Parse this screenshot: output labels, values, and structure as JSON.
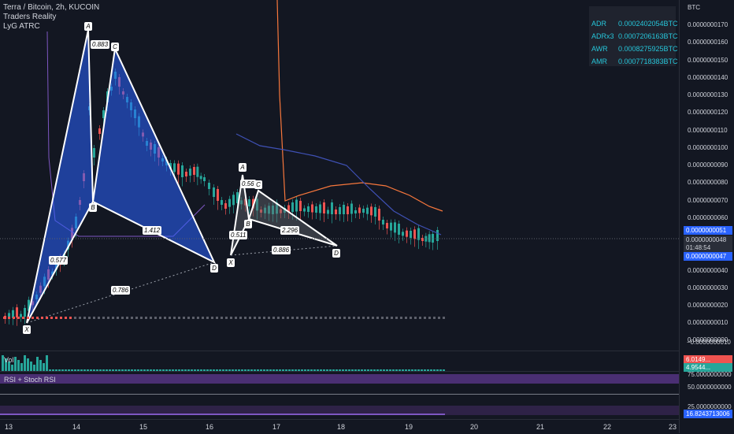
{
  "legend": {
    "title": "Terra / Bitcoin, 2h, KUCOIN",
    "indicator_1": "Traders Reality",
    "indicator_2": "LyG ATRC"
  },
  "stats": [
    {
      "key": "ADR",
      "value": "0.0002402054BTC"
    },
    {
      "key": "ADRx3",
      "value": "0.0007206163BTC"
    },
    {
      "key": "AWR",
      "value": "0.0008275925BTC"
    },
    {
      "key": "AMR",
      "value": "0.0007718383BTC"
    }
  ],
  "price_axis": {
    "unit": "BTC",
    "ticks": [
      "0.0000000170",
      "0.0000000160",
      "0.0000000150",
      "0.0000000140",
      "0.0000000130",
      "0.0000000120",
      "0.0000000110",
      "0.0000000100",
      "0.0000000090",
      "0.0000000080",
      "0.0000000070",
      "0.0000000060",
      "0.0000000040",
      "0.0000000030",
      "0.0000000020",
      "0.0000000010",
      "0.0000000000",
      "−0.0000000010"
    ],
    "tag_high": "0.0000000051",
    "tag_last": "0.0000000048",
    "countdown": "01:48:54",
    "tag_low": "0.0000000047"
  },
  "time_axis": [
    "13",
    "14",
    "15",
    "16",
    "17",
    "18",
    "19",
    "20",
    "21",
    "22",
    "23"
  ],
  "harmonic_1": {
    "points": [
      "X",
      "A",
      "B",
      "C",
      "D"
    ],
    "ratios": [
      "0.883",
      "0.577",
      "1.412",
      "0.786"
    ]
  },
  "harmonic_2": {
    "points": [
      "X",
      "A",
      "B",
      "C",
      "D"
    ],
    "ratios": [
      "0.56",
      "0.511",
      "2.296",
      "0.886"
    ]
  },
  "volume": {
    "label": "Vol",
    "tag_a": "6.0149...",
    "tag_b": "4.9544..."
  },
  "rsi": {
    "label": "RSI + Stoch RSI",
    "ticks": [
      "75.0000000000",
      "50.0000000000",
      "25.0000000000"
    ],
    "tag": "16.8243713006"
  },
  "colors": {
    "background": "#131722",
    "pattern_fill": "#2962ff",
    "up": "#26a69a",
    "down": "#ef5350",
    "ma_orange": "#f7773c",
    "ma_blue": "#3f51b5",
    "tag_blue": "#2962ff",
    "rsi_band": "#7e57c2"
  }
}
